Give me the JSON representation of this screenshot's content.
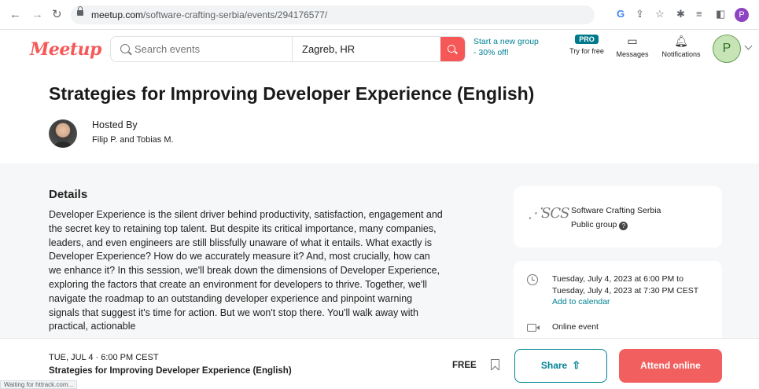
{
  "browser": {
    "url_host": "meetup.com",
    "url_path": "/software-crafting-serbia/events/294176577/",
    "profile_initial": "P",
    "status_text": "Waiting for httrack.com..."
  },
  "header": {
    "logo": "Meetup",
    "search_placeholder": "Search events",
    "location": "Zagreb, HR",
    "promo_line1": "Start a new group",
    "promo_line2": "- 30% off!",
    "pro_badge": "PRO",
    "pro_label": "Try for free",
    "messages_label": "Messages",
    "notifications_label": "Notifications",
    "avatar_initial": "P"
  },
  "event": {
    "title": "Strategies for Improving Developer Experience (English)",
    "hosted_by_label": "Hosted By",
    "hosts": "Filip P. and Tobias M."
  },
  "details": {
    "heading": "Details",
    "description": "Developer Experience is the silent driver behind productivity, satisfaction, engagement and the secret key to retaining top talent. But despite its critical importance, many companies, leaders, and even engineers are still blissfully unaware of what it entails. What exactly is Developer Experience? How do we accurately measure it? And, most crucially, how can we enhance it? In this session, we'll break down the dimensions of Developer Experience, exploring the factors that create an environment for developers to thrive. Together, we'll navigate the roadmap to an outstanding developer experience and pinpoint warning signals that suggest it's time for action. But we won't stop there. You'll walk away with practical, actionable"
  },
  "group": {
    "logo_text": "SCS",
    "name": "Software Crafting Serbia",
    "type": "Public group"
  },
  "when": {
    "line1": "Tuesday, July 4, 2023 at 6:00 PM to",
    "line2": "Tuesday, July 4, 2023 at 7:30 PM CEST",
    "add_calendar": "Add to calendar",
    "location_type": "Online event"
  },
  "footer": {
    "date": "TUE, JUL 4 · 6:00 PM CEST",
    "title": "Strategies for Improving Developer Experience (English)",
    "price": "FREE",
    "share_label": "Share",
    "attend_label": "Attend online"
  },
  "colors": {
    "brand": "#f65858",
    "teal": "#008294",
    "attend": "#f15f5f"
  }
}
